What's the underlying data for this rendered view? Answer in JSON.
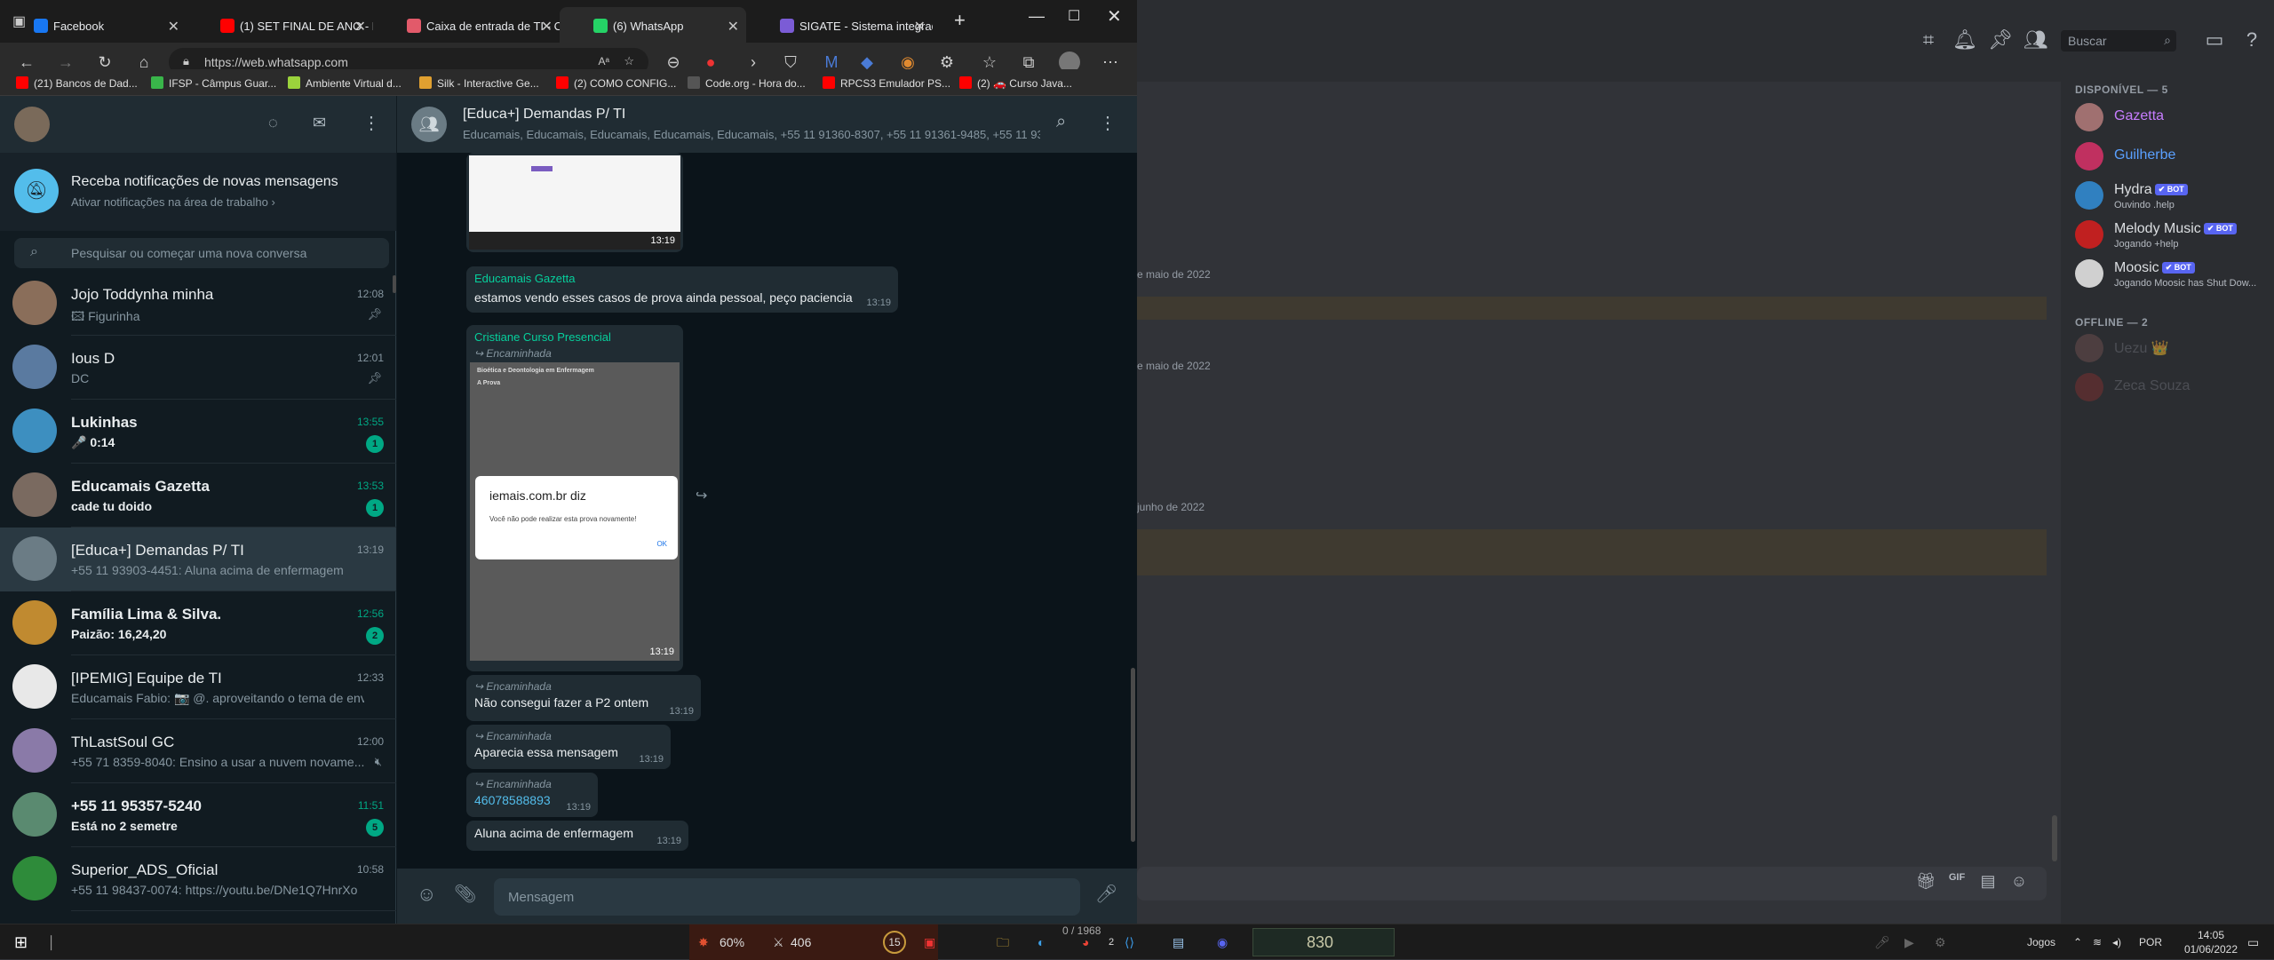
{
  "browser": {
    "tabs": [
      {
        "label": "Facebook",
        "icon": "facebook-icon",
        "color": "#1877f2"
      },
      {
        "label": "(1) SET FINAL DE ANO - D",
        "icon": "youtube-icon",
        "color": "#ff0000"
      },
      {
        "label": "Caixa de entrada de TI - C",
        "icon": "mail-icon",
        "color": "#e25a6a"
      },
      {
        "label": "(6) WhatsApp",
        "icon": "whatsapp-icon",
        "color": "#25d366"
      },
      {
        "label": "SIGATE - Sistema integrad",
        "icon": "sigate-icon",
        "color": "#7b5cd6"
      }
    ],
    "url": "https://web.whatsapp.com",
    "bookmarks": [
      {
        "label": "(21) Bancos de Dad...",
        "color": "#ff0000"
      },
      {
        "label": "IFSP - Câmpus Guar...",
        "color": "#39b54a"
      },
      {
        "label": "Ambiente Virtual d...",
        "color": "#9bd33c"
      },
      {
        "label": "Silk - Interactive Ge...",
        "color": "#e0a030"
      },
      {
        "label": "(2) COMO CONFIG...",
        "color": "#ff0000"
      },
      {
        "label": "Code.org - Hora do...",
        "color": "#555555"
      },
      {
        "label": "RPCS3 Emulador PS...",
        "color": "#ff0000"
      },
      {
        "label": "(2) 🚗 Curso Java...",
        "color": "#ff0000"
      }
    ]
  },
  "whatsapp": {
    "notification": {
      "title": "Receba notificações de novas mensagens",
      "subtitle": "Ativar notificações na área de trabalho ›"
    },
    "search_placeholder": "Pesquisar ou começar uma nova conversa",
    "chats": [
      {
        "name": "Jojo Toddynha minha",
        "time": "12:08",
        "preview": "🖾 Figurinha",
        "pinned": true,
        "unread": "",
        "bold": false,
        "color": "#8a6e5a"
      },
      {
        "name": "Ious D",
        "time": "12:01",
        "preview": "DC",
        "pinned": true,
        "unread": "",
        "bold": false,
        "color": "#5a7aa0"
      },
      {
        "name": "Lukinhas",
        "time": "13:55",
        "preview": "🎤 0:14",
        "pinned": false,
        "unread": "1",
        "bold": true,
        "color": "#3d8fc0"
      },
      {
        "name": "Educamais Gazetta",
        "time": "13:53",
        "preview": "cade tu doido",
        "pinned": false,
        "unread": "1",
        "bold": true,
        "color": "#7a6a60"
      },
      {
        "name": "[Educa+] Demandas P/ TI",
        "time": "13:19",
        "preview": "+55 11 93903-4451: Aluna acima de enfermagem",
        "pinned": false,
        "unread": "",
        "bold": false,
        "color": "#6b7c85"
      },
      {
        "name": "Família Lima & Silva.",
        "time": "12:56",
        "preview": "Paizão: 16,24,20",
        "pinned": false,
        "unread": "2",
        "bold": true,
        "color": "#c08a30"
      },
      {
        "name": "[IPEMIG] Equipe de TI",
        "time": "12:33",
        "preview": "Educamais Fabio: 📷 @. aproveitando o tema de envi...",
        "pinned": false,
        "unread": "",
        "bold": false,
        "color": "#e8e8e8"
      },
      {
        "name": "ThLastSoul GC",
        "time": "12:00",
        "preview": "+55 71 8359-8040: Ensino a usar a nuvem novame...",
        "pinned": false,
        "unread": "",
        "bold": false,
        "color": "#8a7aa8"
      },
      {
        "name": "+55 11 95357-5240",
        "time": "11:51",
        "preview": "Está no 2 semetre",
        "pinned": false,
        "unread": "5",
        "bold": true,
        "color": "#5a8a70"
      },
      {
        "name": "Superior_ADS_Oficial",
        "time": "10:58",
        "preview": "+55 11 98437-0074: https://youtu.be/DNe1Q7HnrXo",
        "pinned": false,
        "unread": "",
        "bold": false,
        "color": "#2e8b3a"
      }
    ],
    "conversation": {
      "title": "[Educa+] Demandas P/ TI",
      "members": "Educamais, Educamais, Educamais, Educamais, Educamais, +55 11 91360-8307, +55 11 91361-9485, +55 11 93...",
      "img1_time": "13:19",
      "msg1": {
        "sender": "Educamais Gazetta",
        "text": "estamos vendo esses casos de prova ainda pessoal, peço paciencia",
        "time": "13:19"
      },
      "msg2": {
        "sender": "Cristiane Curso Presencial",
        "forward": "Encaminhada",
        "time": "13:19",
        "shot_title": "Bioética e Deontologia em Enfermagem",
        "shot_sub": "A Prova",
        "dialog_title": "iemais.com.br diz",
        "dialog_text": "Você não pode realizar esta prova novamente!",
        "dialog_ok": "OK"
      },
      "msg3": {
        "forward": "Encaminhada",
        "text": "Não consegui fazer a P2 ontem",
        "time": "13:19"
      },
      "msg4": {
        "forward": "Encaminhada",
        "text": "Aparecia essa mensagem",
        "time": "13:19"
      },
      "msg5": {
        "forward": "Encaminhada",
        "text": "46078588893",
        "time": "13:19"
      },
      "msg6": {
        "text": "Aluna acima de enfermagem",
        "time": "13:19"
      }
    },
    "input_placeholder": "Mensagem"
  },
  "discord": {
    "search_placeholder": "Buscar",
    "dates": [
      "e maio de 2022",
      "e maio de 2022",
      "junho de 2022"
    ],
    "online_header": "DISPONÍVEL — 5",
    "offline_header": "OFFLINE — 2",
    "bot_tag": "✔ BOT",
    "members_online": [
      {
        "name": "Gazetta",
        "sub": "",
        "bot": false,
        "color": "#c77dff",
        "av": "#a07070"
      },
      {
        "name": "Guilherbe",
        "sub": "",
        "bot": false,
        "color": "#5aa0ff",
        "av": "#c03060"
      },
      {
        "name": "Hydra",
        "sub": "Ouvindo .help",
        "bot": true,
        "color": "#dbdee1",
        "av": "#3080c0"
      },
      {
        "name": "Melody Music",
        "sub": "Jogando +help",
        "bot": true,
        "color": "#dbdee1",
        "av": "#c02020"
      },
      {
        "name": "Moosic",
        "sub": "Jogando Moosic has Shut Dow...",
        "bot": true,
        "color": "#dbdee1",
        "av": "#d0d0d0"
      }
    ],
    "members_offline": [
      {
        "name": "Uezu 👑",
        "color": "#6d6f78",
        "av": "#705050"
      },
      {
        "name": "Zeca Souza",
        "color": "#6d6f78",
        "av": "#803030"
      }
    ]
  },
  "taskbar": {
    "stat1": "60%",
    "stat2": "406",
    "stat3": "15",
    "game_counter": "0 / 1968",
    "discord_badge": "2",
    "game_score": "830",
    "games_label": "Jogos",
    "lang": "POR",
    "time": "14:05",
    "date": "01/06/2022"
  }
}
